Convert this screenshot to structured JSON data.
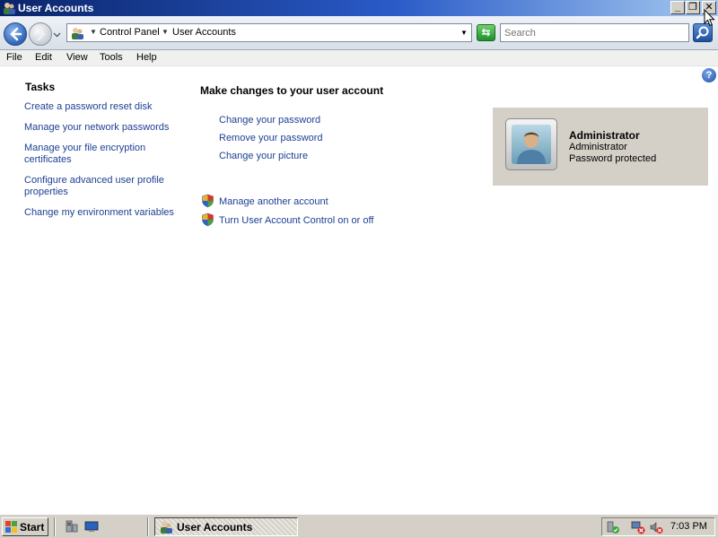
{
  "window": {
    "title": "User Accounts",
    "minimize_label": "_",
    "maximize_label": "❐",
    "close_label": "✕"
  },
  "address": {
    "crumbs": [
      "Control Panel",
      "User Accounts"
    ],
    "search_placeholder": "Search",
    "refresh_glyph": "⇆"
  },
  "menu": [
    "File",
    "Edit",
    "View",
    "Tools",
    "Help"
  ],
  "help_glyph": "?",
  "tasks": {
    "title": "Tasks",
    "links": [
      "Create a password reset disk",
      "Manage your network passwords",
      "Manage your file encryption certificates",
      "Configure advanced user profile properties",
      "Change my environment variables"
    ]
  },
  "main": {
    "title": "Make changes to your user account",
    "links": [
      "Change your password",
      "Remove your password",
      "Change your picture"
    ],
    "shield_links": [
      "Manage another account",
      "Turn User Account Control on or off"
    ]
  },
  "account": {
    "name": "Administrator",
    "type": "Administrator",
    "status": "Password protected"
  },
  "taskbar": {
    "start_label": "Start",
    "task_label": "User Accounts",
    "clock": "7:03 PM"
  },
  "colors": {
    "link": "#1c3f94",
    "titlebar_start": "#0a246a",
    "card_bg": "#d4d0c8"
  }
}
